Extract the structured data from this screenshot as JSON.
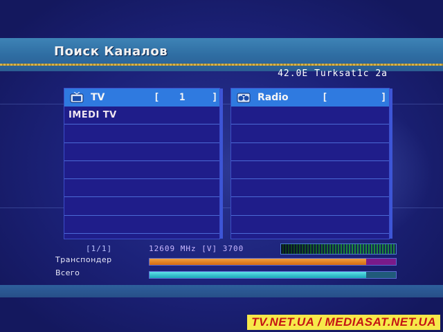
{
  "header": {
    "title": "Поиск Каналов",
    "satellite": "42.0E Turksat1c 2a"
  },
  "tv_panel": {
    "label": "TV",
    "count_open": "[",
    "count": "1",
    "count_close": "]",
    "channels": [
      "IMEDI TV",
      "",
      "",
      "",
      "",
      "",
      "",
      ""
    ]
  },
  "radio_panel": {
    "label": "Radio",
    "count_open": "[",
    "count": "",
    "count_close": "]",
    "channels": [
      "",
      "",
      "",
      "",
      "",
      "",
      "",
      ""
    ]
  },
  "status": {
    "page": "[1/1]",
    "frequency": "12609 MHz [V] 3700",
    "transponder_label": "Транспондер",
    "total_label": "Всего",
    "transponder_progress": 0.88,
    "total_progress": 0.88,
    "signal_level": 1.0
  },
  "watermark": "TV.NET.UA / MEDIASAT.NET.UA",
  "colors": {
    "header": "#2f6ea3",
    "panel_header": "#2f7ae0",
    "panel": "#1f1d8a",
    "transponder_bar": "#d46a10",
    "total_bar": "#1aa6b8",
    "watermark_bg": "#f7e84a",
    "watermark_text": "#c41414"
  }
}
